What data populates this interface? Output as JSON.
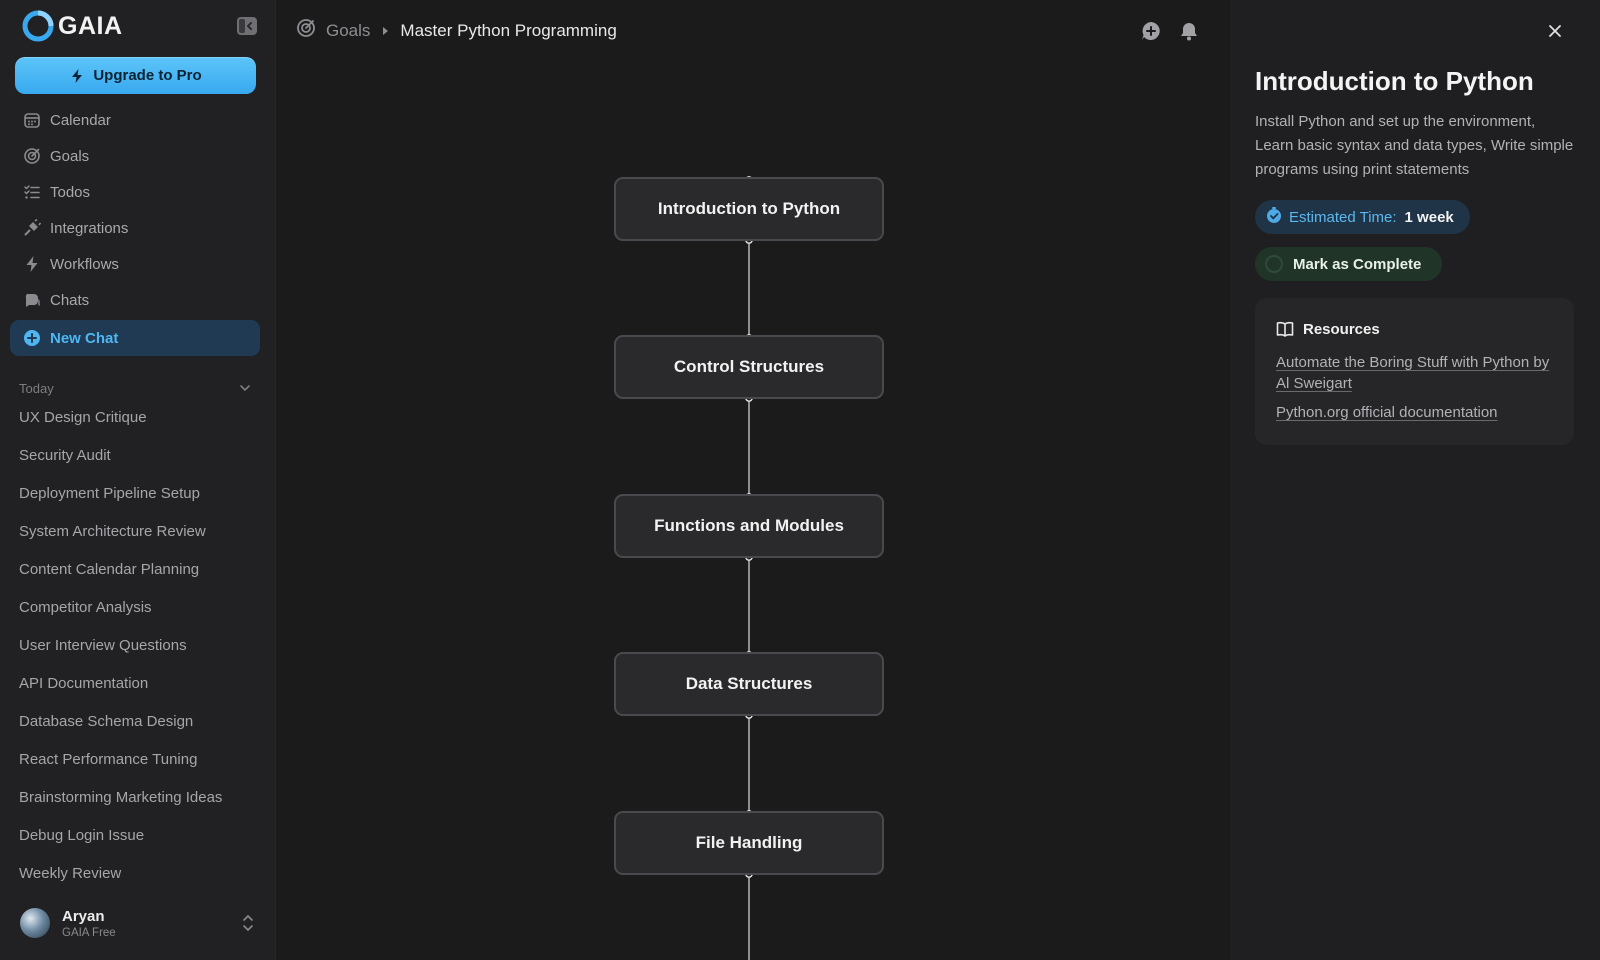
{
  "brand": {
    "name": "GAIA"
  },
  "sidebar": {
    "upgrade_label": "Upgrade to Pro",
    "nav": [
      {
        "label": "Calendar",
        "icon": "calendar-icon"
      },
      {
        "label": "Goals",
        "icon": "goals-icon"
      },
      {
        "label": "Todos",
        "icon": "todos-icon"
      },
      {
        "label": "Integrations",
        "icon": "plug-icon"
      },
      {
        "label": "Workflows",
        "icon": "bolt-icon"
      },
      {
        "label": "Chats",
        "icon": "chats-icon"
      }
    ],
    "new_chat_label": "New Chat",
    "section_label": "Today",
    "chats": [
      "UX Design Critique",
      "Security Audit",
      "Deployment Pipeline Setup",
      "System Architecture Review",
      "Content Calendar Planning",
      "Competitor Analysis",
      "User Interview Questions",
      "API Documentation",
      "Database Schema Design",
      "React Performance Tuning",
      "Brainstorming Marketing Ideas",
      "Debug Login Issue",
      "Weekly Review"
    ],
    "user": {
      "name": "Aryan",
      "plan": "GAIA Free"
    }
  },
  "header": {
    "breadcrumb_root": "Goals",
    "breadcrumb_current": "Master Python Programming"
  },
  "flow": {
    "nodes": [
      "Introduction to Python",
      "Control Structures",
      "Functions and Modules",
      "Data Structures",
      "File Handling"
    ]
  },
  "panel": {
    "title": "Introduction to Python",
    "description": "Install Python and set up the environment, Learn basic syntax and data types, Write simple programs using print statements",
    "estimated_label": "Estimated Time:",
    "estimated_value": "1 week",
    "complete_label": "Mark as Complete",
    "resources_title": "Resources",
    "resources": [
      "Automate the Boring Stuff with Python by Al Sweigart",
      "Python.org official documentation"
    ]
  },
  "colors": {
    "accent": "#38a9ef",
    "active_bg": "#1f3a52",
    "background": "#1b1b1c",
    "sidebar_bg": "#212123",
    "complete_bg": "#203528"
  }
}
